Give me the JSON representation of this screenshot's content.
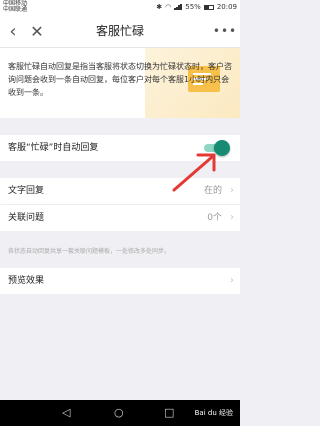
{
  "status_bar": {
    "carrier_1": "中国移动",
    "carrier_2": "中国联通",
    "battery": "55%",
    "time": "20:09"
  },
  "nav": {
    "title": "客服忙碌",
    "back_icon": "‹",
    "close_icon": "✕",
    "more_icon": "•••"
  },
  "intro": {
    "text": "客服忙碌自动回复是指当客服将状态切换为忙碌状态时，客户咨询问题会收到一条自动回复，每位客户对每个客服1小时内只会收到一条。"
  },
  "settings": {
    "auto_reply_label": "客服“忙碌”时自动回复",
    "auto_reply_on": true,
    "text_reply_label": "文字回复",
    "text_reply_value": "在的",
    "related_label": "关联问题",
    "related_value": "0个",
    "hint": "各状态自动回复共享一套关联问题模板，一处修改多处同步。",
    "preview_label": "预览效果",
    "chevron": "›"
  },
  "bottom_nav": {
    "back": "◁",
    "home": "○",
    "recent": "□",
    "watermark": "Bai du 经验"
  },
  "colors": {
    "toggle_on": "#168a72",
    "arrow": "#e53935"
  }
}
